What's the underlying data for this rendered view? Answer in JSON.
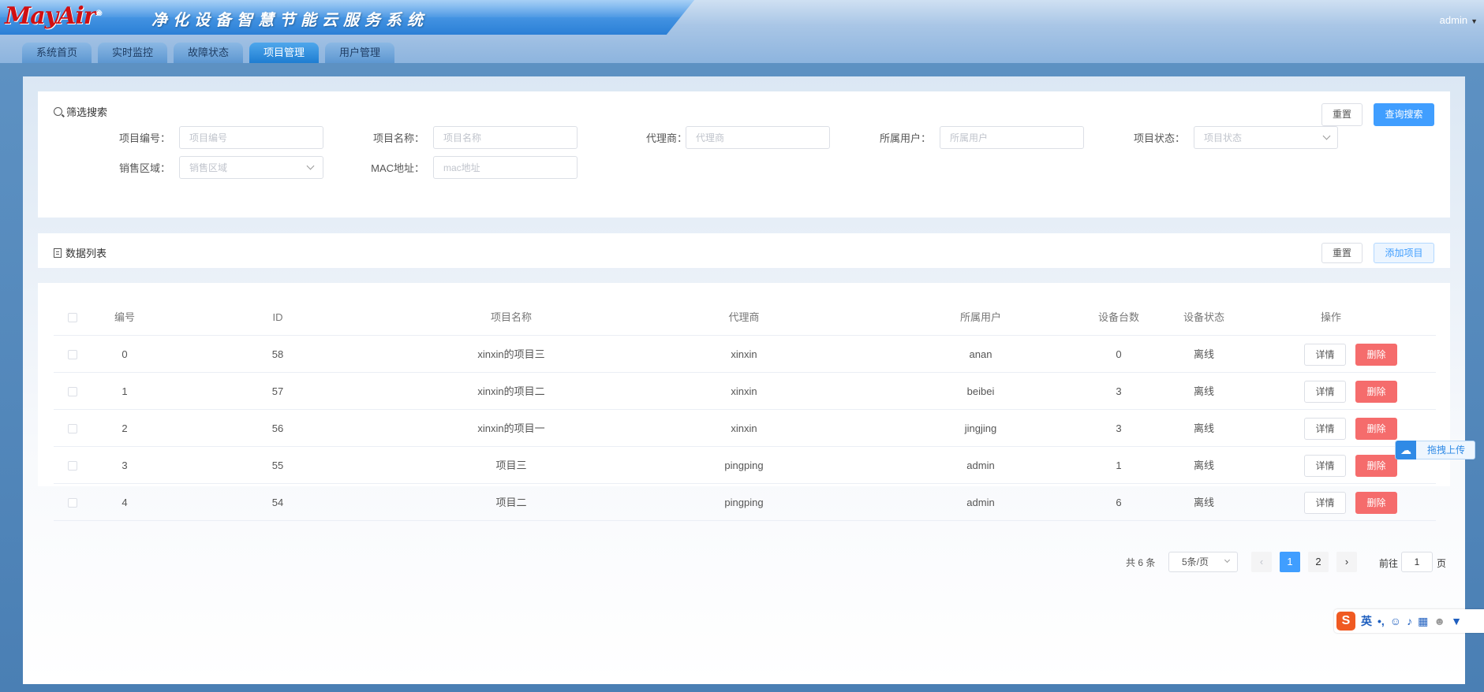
{
  "header": {
    "logo": "MayAir",
    "logo_mark": "®",
    "system_title": "净化设备智慧节能云服务系统",
    "user": "admin"
  },
  "nav": [
    "系统首页",
    "实时监控",
    "故障状态",
    "项目管理",
    "用户管理"
  ],
  "active_nav": "项目管理",
  "filter": {
    "title": "筛选搜索",
    "reset_label": "重置",
    "search_label": "查询搜索",
    "fields": [
      {
        "label": "项目编号：",
        "placeholder": "项目编号"
      },
      {
        "label": "项目名称：",
        "placeholder": "项目名称"
      },
      {
        "label": "代理商：",
        "placeholder": "代理商"
      },
      {
        "label": "所属用户：",
        "placeholder": "所属用户"
      },
      {
        "label": "项目状态：",
        "placeholder": "项目状态"
      },
      {
        "label": "销售区域：",
        "placeholder": "销售区域"
      },
      {
        "label": "MAC地址：",
        "placeholder": "mac地址"
      }
    ]
  },
  "list": {
    "title": "数据列表",
    "reset_label": "重置",
    "add_label": "添加项目"
  },
  "table": {
    "columns": [
      "编号",
      "ID",
      "项目名称",
      "代理商",
      "所属用户",
      "设备台数",
      "设备状态",
      "操作"
    ],
    "rows": [
      {
        "index": "0",
        "id": "58",
        "name": "xinxin的项目三",
        "agent": "xinxin",
        "user": "anan",
        "devices": "0",
        "status": "离线"
      },
      {
        "index": "1",
        "id": "57",
        "name": "xinxin的项目二",
        "agent": "xinxin",
        "user": "beibei",
        "devices": "3",
        "status": "离线"
      },
      {
        "index": "2",
        "id": "56",
        "name": "xinxin的项目一",
        "agent": "xinxin",
        "user": "jingjing",
        "devices": "3",
        "status": "离线"
      },
      {
        "index": "3",
        "id": "55",
        "name": "项目三",
        "agent": "pingping",
        "user": "admin",
        "devices": "1",
        "status": "离线"
      },
      {
        "index": "4",
        "id": "54",
        "name": "项目二",
        "agent": "pingping",
        "user": "admin",
        "devices": "6",
        "status": "离线"
      }
    ],
    "detail_label": "详情",
    "delete_label": "删除"
  },
  "pagination": {
    "total": "共 6 条",
    "page_size": "5条/页",
    "pages": [
      "1",
      "2"
    ],
    "current_page": "1",
    "goto_prefix": "前往",
    "goto_value": "1",
    "goto_suffix": "页"
  },
  "upload_widget": {
    "label": "拖拽上传"
  },
  "ime": {
    "logo": "S",
    "mode": "英",
    "punct": "•,"
  },
  "colors": {
    "primary": "#409eff",
    "danger": "#f56c6c",
    "nav_active": "#1e7dd2"
  }
}
